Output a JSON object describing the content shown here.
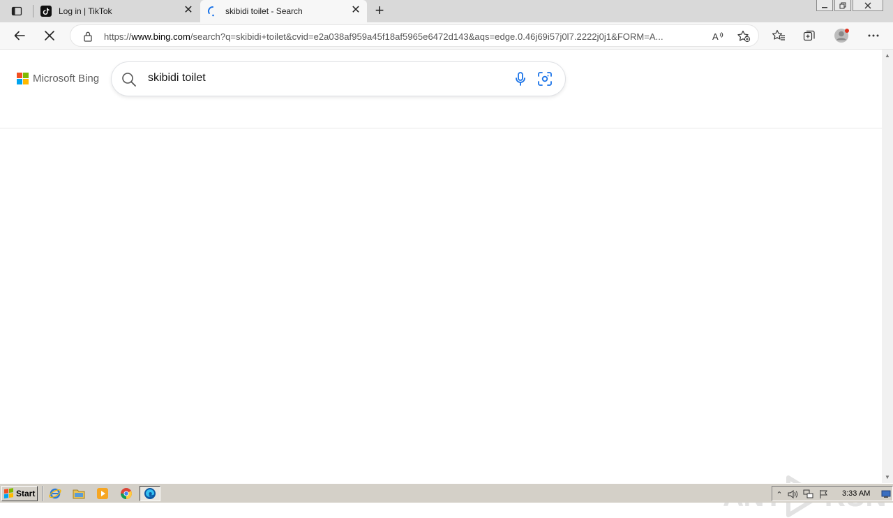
{
  "browser": {
    "tabs": [
      {
        "title": "Log in | TikTok",
        "active": false,
        "favicon": "tiktok-icon"
      },
      {
        "title": "skibidi toilet - Search",
        "active": true,
        "favicon": "loading-spinner-icon"
      }
    ],
    "address": {
      "url_prefix": "https://",
      "url_host": "www.bing.com",
      "url_rest": "/search?q=skibidi+toilet&cvid=e2a038af959a45f18af5965e6472d143&aqs=edge.0.46j69i57j0l7.2222j0j1&FORM=A..."
    }
  },
  "page": {
    "logo_text": "Microsoft Bing",
    "search_query": "skibidi toilet"
  },
  "watermark": {
    "left": "ANY",
    "right": "RUN"
  },
  "taskbar": {
    "start_label": "Start",
    "clock": "3:33 AM"
  },
  "colors": {
    "ms_red": "#f25022",
    "ms_green": "#7fba00",
    "ms_blue": "#00a4ef",
    "ms_yellow": "#ffb900",
    "mic_blue": "#1a73e8"
  }
}
